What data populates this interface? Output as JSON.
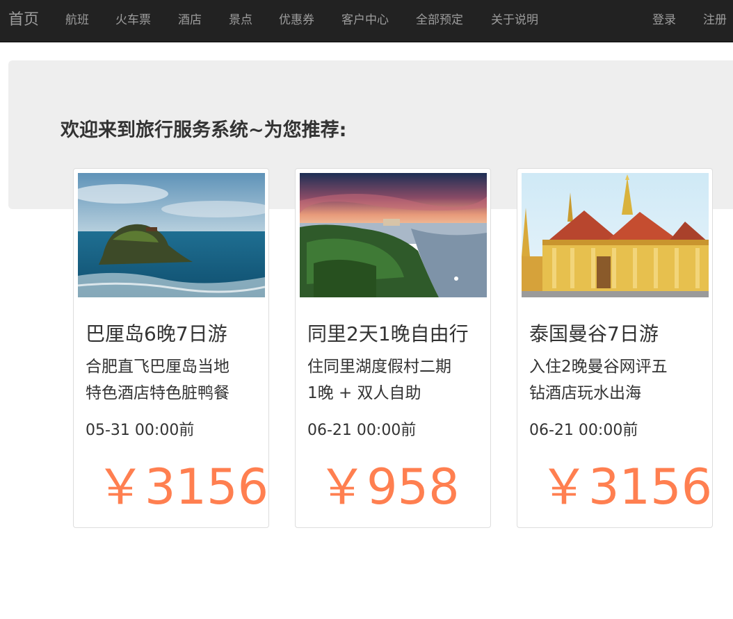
{
  "navbar": {
    "brand": "首页",
    "items": [
      "航班",
      "火车票",
      "酒店",
      "景点",
      "优惠券",
      "客户中心",
      "全部预定",
      "关于说明"
    ],
    "right_items": [
      "登录",
      "注册"
    ]
  },
  "jumbotron": {
    "heading": "欢迎来到旅行服务系统~为您推荐:"
  },
  "cards": [
    {
      "image_icon": "bali-sea-temple-image",
      "title": "巴厘岛6晚7日游",
      "desc_line1": "合肥直飞巴厘岛当地",
      "desc_line2": "特色酒店特色脏鸭餐",
      "deadline": "05-31 00:00前",
      "price": "￥3156"
    },
    {
      "image_icon": "tongli-lake-sunset-image",
      "title": "同里2天1晚自由行",
      "desc_line1": "住同里湖度假村二期",
      "desc_line2": "1晚 + 双人自助",
      "deadline": "06-21 00:00前",
      "price": "￥958"
    },
    {
      "image_icon": "bangkok-temple-image",
      "title": "泰国曼谷7日游",
      "desc_line1": "入住2晚曼谷网评五",
      "desc_line2": "钻酒店玩水出海",
      "deadline": "06-21 00:00前",
      "price": "￥3156"
    }
  ],
  "colors": {
    "navbar_bg": "#222222",
    "nav_text": "#9d9d9d",
    "jumbotron_bg": "#eeeeee",
    "price": "#ff7f50"
  }
}
